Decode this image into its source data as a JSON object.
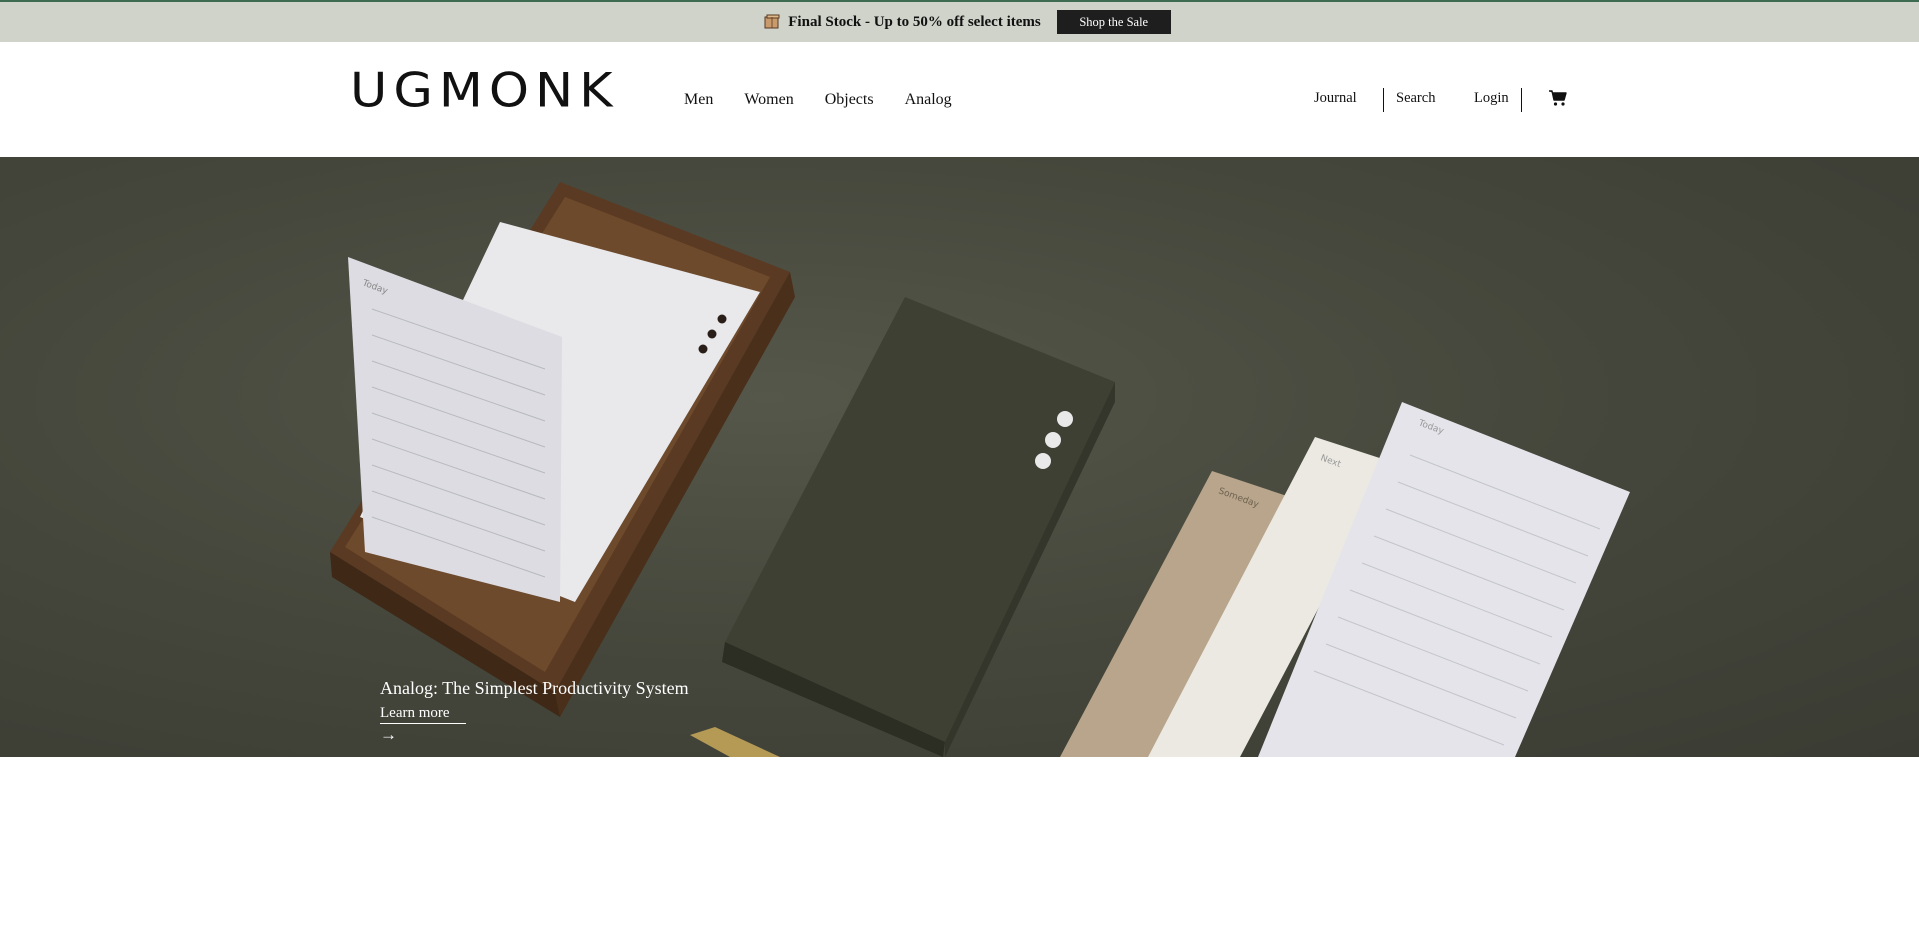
{
  "announcement": {
    "icon": "box-icon",
    "text": "Final Stock - Up to 50% off select items",
    "button_label": "Shop the Sale",
    "colors": {
      "bar_bg": "#cfd3ca",
      "button_bg": "#1e1e1e"
    }
  },
  "header": {
    "logo": "UGMONK",
    "nav": [
      "Men",
      "Women",
      "Objects",
      "Analog"
    ],
    "utility": {
      "journal": "Journal",
      "search": "Search",
      "login": "Login",
      "cart_icon": "cart-icon"
    }
  },
  "hero": {
    "title": "Analog: The Simplest Productivity System",
    "link": "Learn more",
    "arrow": "→",
    "card_labels": {
      "today": "Today",
      "next": "Next",
      "someday": "Someday"
    },
    "colors": {
      "background": "#45473c",
      "box": "#3e4033",
      "wood": "#5a3a22"
    }
  }
}
